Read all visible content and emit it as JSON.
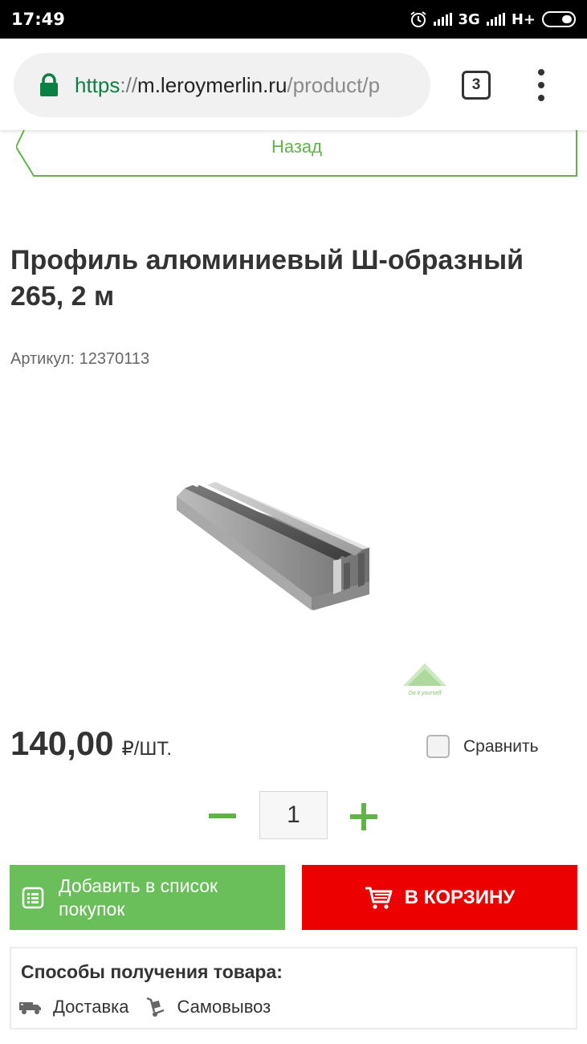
{
  "status_bar": {
    "time": "17:49",
    "network": "3G",
    "network2": "H+",
    "icons": [
      "alarm-icon",
      "signal-icon",
      "battery-icon"
    ]
  },
  "browser": {
    "url_scheme": "https",
    "url_sep": "://",
    "url_host": "m.leroymerlin.ru",
    "url_path": "/product/p",
    "tab_count": "3"
  },
  "nav": {
    "back_label": "Назад"
  },
  "product": {
    "title": "Профиль алюминиевый Ш-образный 265, 2 м",
    "sku": "Артикул: 12370113",
    "price": "140,00",
    "price_unit": "₽/ШТ.",
    "compare_label": "Сравнить",
    "quantity": "1"
  },
  "actions": {
    "add_to_list_label": "Добавить в список покупок",
    "add_to_cart_label": "В КОРЗИНУ"
  },
  "delivery": {
    "title": "Способы получения товара:",
    "options": [
      {
        "label": "Доставка",
        "icon": "truck-icon"
      },
      {
        "label": "Самовывоз",
        "icon": "hand-truck-icon"
      }
    ]
  },
  "colors": {
    "accent_green": "#5eb546",
    "cart_red": "#ec0000",
    "list_green": "#6abf5a"
  }
}
